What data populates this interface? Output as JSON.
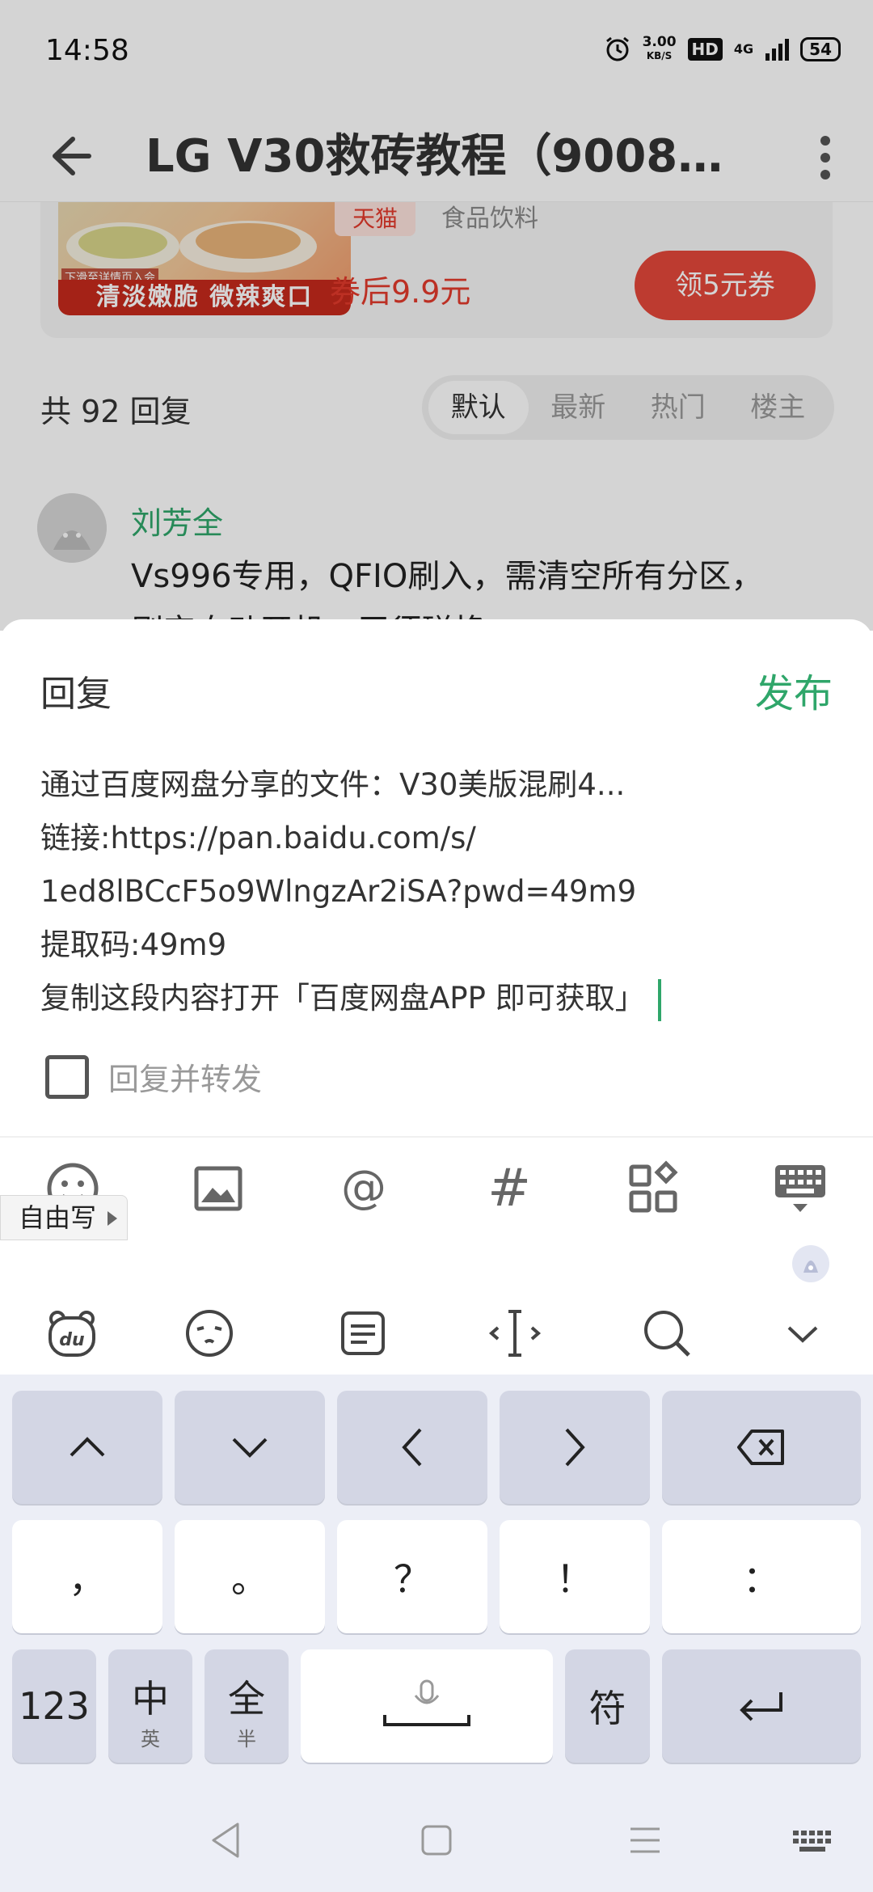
{
  "status": {
    "time": "14:58",
    "speed_value": "3.00",
    "speed_unit": "KB/S",
    "hd": "HD",
    "network": "4G",
    "battery": "54"
  },
  "appbar": {
    "title": "LG V30救砖教程（9008..."
  },
  "ad": {
    "image_small_text": "下滑至详情页入会",
    "image_slogan": "清淡嫩脆 微辣爽口",
    "store_tag": "天猫",
    "category": "食品饮料",
    "price": "券后9.9元",
    "coupon_button": "领5元券"
  },
  "replies": {
    "count_label": "共 92 回复",
    "sort_tabs": [
      {
        "label": "默认",
        "active": true
      },
      {
        "label": "最新",
        "active": false
      },
      {
        "label": "热门",
        "active": false
      },
      {
        "label": "楼主",
        "active": false
      }
    ],
    "first_comment": {
      "author": "刘芳全",
      "text": "Vs996专用，QFIO刷入，需清空所有分区，",
      "text_line2": "刷完自动开机，无须磁换"
    }
  },
  "reply_sheet": {
    "title": "回复",
    "publish_label": "发布",
    "content_lines": [
      "通过百度网盘分享的文件：V30美版混刷4...",
      "链接:https://pan.baidu.com/s/",
      "1ed8lBCcF5o9WlngzAr2iSA?pwd=49m9",
      "提取码:49m9",
      "复制这段内容打开「百度网盘APP 即可获取」"
    ],
    "forward_label": "回复并转发",
    "forward_checked": false
  },
  "toolbar": {
    "icons": [
      "emoji-icon",
      "image-icon",
      "at-icon",
      "hashtag-icon",
      "apps-icon",
      "keyboard-hide-icon"
    ],
    "at_symbol": "@",
    "hash_symbol": "#"
  },
  "keyboard": {
    "freewrite_label": "自由写",
    "row1": [
      "︿",
      "﹀",
      "〈",
      "〉"
    ],
    "punct": [
      "，",
      "。",
      "？",
      "！",
      "："
    ],
    "num_label": "123",
    "lang_main": "中",
    "lang_sub": "英",
    "width_main": "全",
    "width_sub": "半",
    "symbol_label": "符"
  },
  "colors": {
    "accent_green": "#2fa66a",
    "coupon_red": "#e4483a",
    "keyboard_bg": "#eceef6"
  }
}
